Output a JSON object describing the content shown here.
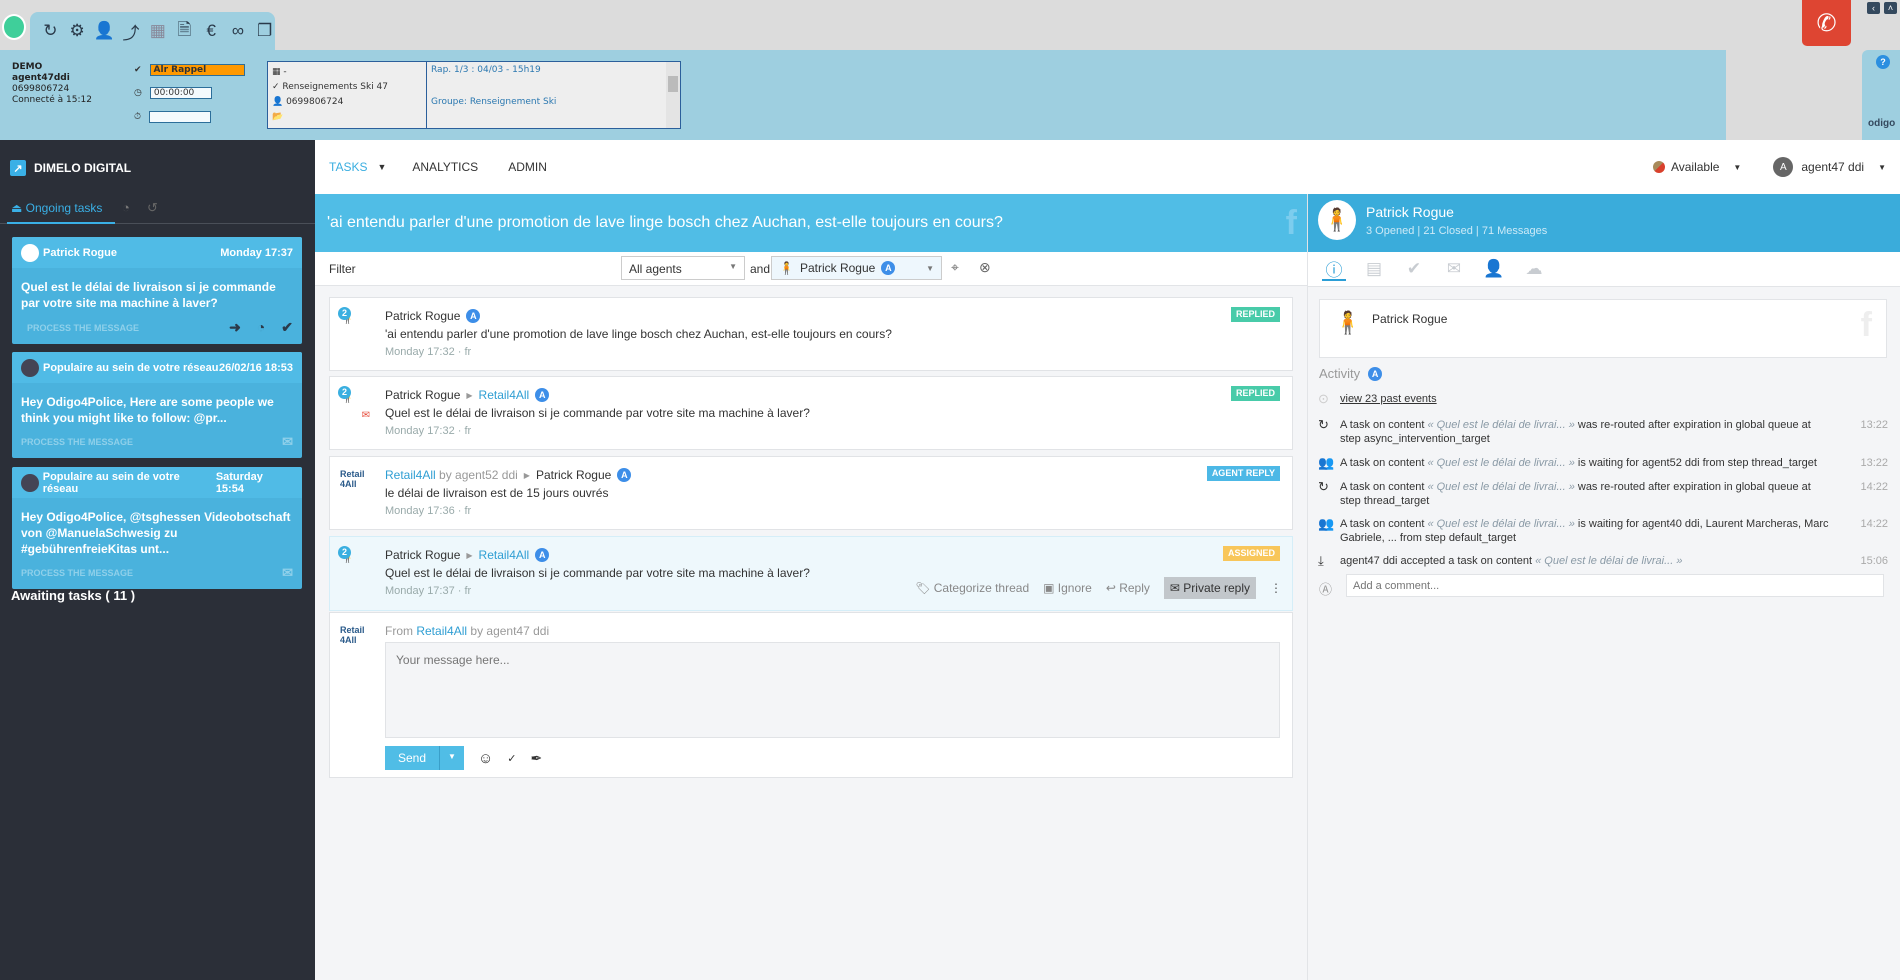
{
  "toolbar": {
    "icons": [
      "refresh-icon",
      "settings-icon",
      "agent-chat-icon",
      "stats-icon",
      "grid-cursor-icon",
      "document-coffee-icon",
      "call-cost-icon",
      "infinity-icon",
      "windows-icon"
    ]
  },
  "cti": {
    "company": "DEMO",
    "agent": "agent47ddi",
    "phone": "0699806724",
    "connected": "Connecté à 15:12",
    "status": "Alr Rappel",
    "timer": "00:00:00",
    "timer2": "",
    "line1": "-",
    "line2": "Renseignements Ski 47",
    "line3": "0699806724",
    "rap": "Rap. 1/3 : 04/03 - 15h19",
    "group": "Groupe: Renseignement Ski",
    "logo": "odigo",
    "help": "?"
  },
  "colors": {
    "accent": "#50bde6",
    "sidebar": "#2b2f38",
    "replied": "#48cba9",
    "agent_reply": "#4cb8e6",
    "assigned": "#f8c65a",
    "call": "#de4532"
  },
  "sidebar": {
    "brand": "DIMELO DIGITAL",
    "tab_ongoing": "Ongoing tasks",
    "cards": [
      {
        "name": "Patrick Rogue",
        "time": "Monday 17:37",
        "text": "Quel est le délai de livraison si je commande par votre site ma machine à laver?",
        "action": "PROCESS THE MESSAGE"
      },
      {
        "name": "Populaire au sein de votre réseau",
        "time": "26/02/16 18:53",
        "text": "Hey Odigo4Police, Here are some people we think you might like to follow: @pr...",
        "action": "PROCESS THE MESSAGE"
      },
      {
        "name": "Populaire au sein de votre réseau",
        "time": "Saturday 15:54",
        "text": "Hey Odigo4Police, @tsghessen Videobotschaft von @ManuelaSchwesig zu #gebührenfreieKitas unt...",
        "action": "PROCESS THE MESSAGE"
      }
    ],
    "awaiting": "Awaiting tasks ( 11 )"
  },
  "nav": {
    "tasks": "TASKS",
    "analytics": "ANALYTICS",
    "admin": "ADMIN",
    "status": "Available",
    "user": "agent47 ddi",
    "user_initial": "A"
  },
  "thread": {
    "title": "'ai entendu parler d'une promotion de lave linge bosch chez Auchan, est-elle toujours en cours?"
  },
  "filter": {
    "label": "Filter",
    "agents": "All agents",
    "and": "and",
    "contact": "Patrick Rogue",
    "badge": "A"
  },
  "messages": [
    {
      "from": "Patrick Rogue",
      "to": "",
      "text": "'ai entendu parler d'une promotion de lave linge bosch chez Auchan, est-elle toujours en cours?",
      "time": "Monday 17:32",
      "lang": "fr",
      "status": "REPLIED",
      "count": "2"
    },
    {
      "from": "Patrick Rogue",
      "to": "Retail4All",
      "text": "Quel est le délai de livraison si je commande par votre site ma machine à laver?",
      "time": "Monday 17:32",
      "lang": "fr",
      "status": "REPLIED",
      "count": "2"
    },
    {
      "from": "Retail4All",
      "by": "by agent52 ddi",
      "to": "Patrick Rogue",
      "text": "le délai de livraison est de 15 jours ouvrés",
      "time": "Monday 17:36",
      "lang": "fr",
      "status": "AGENT REPLY"
    },
    {
      "from": "Patrick Rogue",
      "to": "Retail4All",
      "text": "Quel est le délai de livraison si je commande par votre site ma machine à laver?",
      "time": "Monday 17:37",
      "lang": "fr",
      "status": "ASSIGNED",
      "count": "2"
    }
  ],
  "actions": {
    "categorize": "Categorize thread",
    "ignore": "Ignore",
    "reply": "Reply",
    "private_reply": "Private reply"
  },
  "composer": {
    "from_label": "From",
    "from": "Retail4All",
    "by": "by agent47 ddi",
    "placeholder": "Your message here...",
    "send": "Send",
    "logo_text": "Retail 4All"
  },
  "profile": {
    "name": "Patrick Rogue",
    "opened": "3 Opened",
    "closed": "21 Closed",
    "messages": "71 Messages",
    "sep": "|"
  },
  "activity": {
    "title": "Activity",
    "badge": "A",
    "past": "view 23 past events",
    "events": [
      {
        "icon": "reroute-icon",
        "pre": "A task on content",
        "quote": "« Quel est le délai de livrai... »",
        "post": "was re-routed after expiration in global queue at step async_intervention_target",
        "time": "13:22"
      },
      {
        "icon": "waiting-user-icon",
        "pre": "A task on content",
        "quote": "« Quel est le délai de livrai... »",
        "post": "is waiting for agent52 ddi from step thread_target",
        "time": "13:22"
      },
      {
        "icon": "reroute-icon",
        "pre": "A task on content",
        "quote": "« Quel est le délai de livrai... »",
        "post": "was re-routed after expiration in global queue at step thread_target",
        "time": "14:22"
      },
      {
        "icon": "waiting-user-icon",
        "pre": "A task on content",
        "quote": "« Quel est le délai de livrai... »",
        "post": "is waiting for agent40 ddi, Laurent Marcheras, Marc Gabriele, ... from step default_target",
        "time": "14:22"
      },
      {
        "icon": "accept-icon",
        "pre": "agent47 ddi accepted a task on content",
        "quote": "« Quel est le délai de livrai... »",
        "post": "",
        "time": "15:06"
      }
    ],
    "comment_placeholder": "Add a comment..."
  }
}
